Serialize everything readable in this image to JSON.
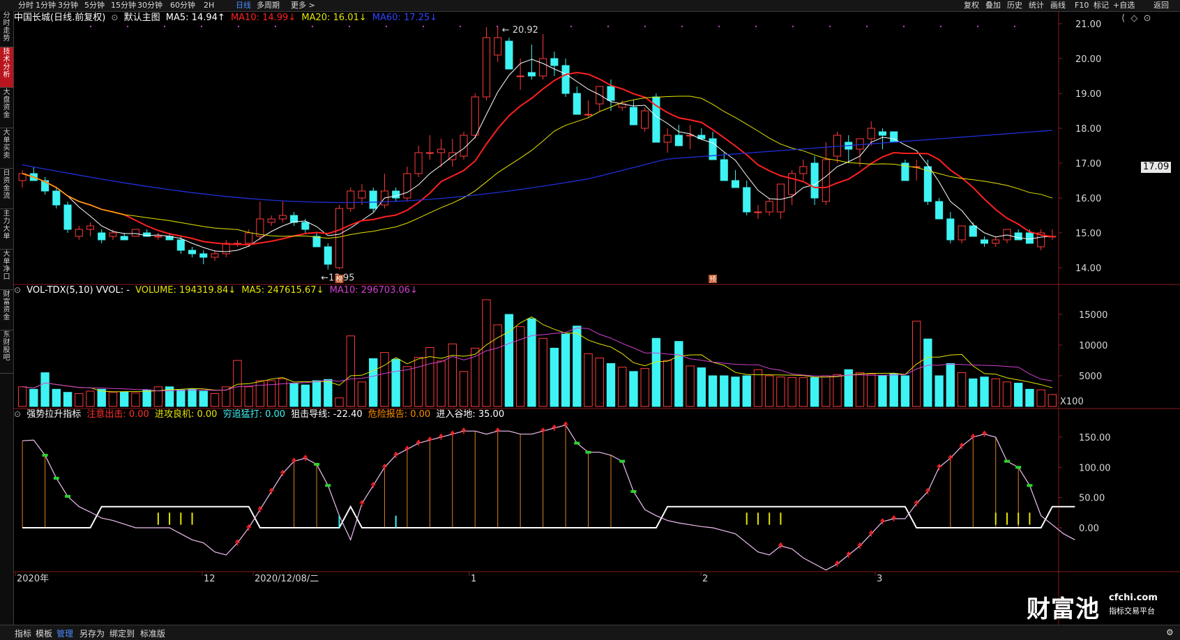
{
  "top_periods": [
    "分时",
    "1分钟",
    "3分钟",
    "5分钟",
    "15分钟",
    "30分钟",
    "60分钟",
    "2H",
    "日线",
    "多周期",
    "更多 >"
  ],
  "active_period": "日线",
  "top_tools": [
    "复权",
    "叠加",
    "历史",
    "统计",
    "画线",
    "F10",
    "标记",
    "+自选",
    "返回"
  ],
  "sidebar_tabs": [
    "分时走势",
    "技术分析",
    "大盘资金",
    "大单买卖",
    "日资金流",
    "主力大单",
    "大单净口",
    "财富资金",
    "东财股吧"
  ],
  "active_sidebar": "技术分析",
  "main_legend": {
    "stock": "中国长城(日线.前复权)",
    "template": "默认主图",
    "ma5": "MA5: 14.94↑",
    "ma10": "MA10: 14.99↓",
    "ma20": "MA20: 16.01↓",
    "ma60": "MA60: 17.25↓"
  },
  "vol_legend": {
    "name": "VOL-TDX(5,10) VVOL: -",
    "volume": "VOLUME: 194319.84↓",
    "ma5": "MA5: 247615.67↓",
    "ma10": "MA10: 296703.06↓"
  },
  "ind_legend": {
    "name": "强势拉升指标",
    "a": "注意出击: 0.00",
    "b": "进攻良机: 0.00",
    "c": "穷追猛打: 0.00",
    "d": "狙击导线: -22.40",
    "e": "危险报告: 0.00",
    "f": "进入谷地: 35.00"
  },
  "price_axis": [
    "21.00",
    "20.00",
    "19.00",
    "18.00",
    "17.00",
    "16.00",
    "15.00",
    "14.00"
  ],
  "current_price": "17.09",
  "vol_axis": [
    "15000",
    "10000",
    "5000"
  ],
  "vol_unit": "X100",
  "ind_axis": [
    "150.00",
    "100.00",
    "50.00",
    "0.00"
  ],
  "high_label": "20.92",
  "low_label": "13.95",
  "date_axis": [
    "2020年",
    "12",
    "2020/12/08/二",
    "1",
    "2",
    "3"
  ],
  "marker_bang": "榜",
  "marker_yu": "预",
  "bottom_tabs": [
    "指标",
    "模板",
    "管理",
    "另存为",
    "绑定到",
    "标准版"
  ],
  "active_bottom": "管理",
  "watermark": {
    "brand": "财富池",
    "site": "cfchi.com",
    "slogan": "指标交易平台"
  },
  "colors": {
    "up": "#ff3b3b",
    "down": "#3ef3f3",
    "ma5": "#ffffff",
    "ma10": "#ff2020",
    "ma20": "#e6e600",
    "ma60": "#1f2fd9",
    "vma5": "#e6e600",
    "vma10": "#d040d0"
  },
  "chart_data": {
    "type": "candlestick",
    "candles": [
      [
        16.5,
        16.8,
        16.3,
        16.7
      ],
      [
        16.7,
        16.9,
        16.5,
        16.5
      ],
      [
        16.5,
        16.6,
        16.1,
        16.2
      ],
      [
        16.2,
        16.3,
        15.7,
        15.8
      ],
      [
        15.8,
        15.9,
        15.0,
        15.1
      ],
      [
        14.9,
        15.2,
        14.8,
        15.1
      ],
      [
        15.1,
        15.3,
        14.9,
        15.2
      ],
      [
        15.0,
        15.1,
        14.7,
        14.8
      ],
      [
        14.9,
        15.1,
        14.8,
        15.0
      ],
      [
        14.9,
        15.0,
        14.8,
        14.8
      ],
      [
        14.9,
        15.1,
        14.9,
        15.1
      ],
      [
        15.0,
        15.1,
        14.9,
        14.9
      ],
      [
        14.9,
        15.0,
        14.8,
        14.9
      ],
      [
        14.9,
        15.0,
        14.8,
        14.8
      ],
      [
        14.8,
        14.9,
        14.4,
        14.5
      ],
      [
        14.5,
        14.6,
        14.3,
        14.4
      ],
      [
        14.4,
        14.5,
        14.1,
        14.3
      ],
      [
        14.3,
        14.5,
        14.2,
        14.4
      ],
      [
        14.4,
        14.8,
        14.3,
        14.7
      ],
      [
        14.7,
        14.8,
        14.6,
        14.7
      ],
      [
        14.7,
        15.1,
        14.6,
        15.0
      ],
      [
        14.9,
        15.9,
        14.8,
        15.4
      ],
      [
        15.3,
        15.5,
        15.2,
        15.4
      ],
      [
        15.4,
        15.9,
        15.3,
        15.5
      ],
      [
        15.5,
        15.6,
        15.2,
        15.3
      ],
      [
        15.3,
        15.4,
        15.0,
        15.1
      ],
      [
        14.9,
        15.0,
        14.6,
        14.6
      ],
      [
        14.6,
        14.7,
        13.95,
        14.1
      ],
      [
        14.0,
        15.8,
        13.95,
        15.7
      ],
      [
        15.7,
        16.3,
        15.6,
        16.2
      ],
      [
        16.0,
        16.4,
        15.8,
        16.2
      ],
      [
        16.2,
        16.3,
        15.6,
        15.7
      ],
      [
        15.8,
        16.7,
        15.7,
        16.2
      ],
      [
        16.2,
        16.3,
        15.9,
        16.0
      ],
      [
        16.0,
        16.9,
        15.9,
        16.7
      ],
      [
        16.7,
        17.5,
        16.6,
        17.3
      ],
      [
        17.3,
        17.8,
        17.1,
        17.3
      ],
      [
        17.3,
        17.7,
        16.9,
        17.4
      ],
      [
        17.1,
        17.7,
        16.9,
        17.3
      ],
      [
        17.2,
        17.9,
        17.1,
        17.8
      ],
      [
        17.8,
        19.0,
        17.7,
        18.9
      ],
      [
        18.9,
        20.9,
        18.8,
        20.6
      ],
      [
        20.1,
        20.92,
        19.9,
        20.6
      ],
      [
        20.5,
        20.6,
        19.8,
        19.7
      ],
      [
        19.5,
        20.0,
        19.1,
        19.5
      ],
      [
        19.6,
        20.4,
        19.4,
        19.5
      ],
      [
        19.5,
        20.7,
        19.4,
        20.0
      ],
      [
        20.0,
        20.2,
        19.5,
        19.8
      ],
      [
        19.8,
        20.0,
        18.9,
        19.0
      ],
      [
        19.0,
        19.2,
        18.4,
        18.4
      ],
      [
        18.4,
        18.8,
        18.3,
        18.4
      ],
      [
        18.7,
        19.2,
        18.5,
        19.2
      ],
      [
        19.2,
        19.4,
        18.5,
        18.8
      ],
      [
        18.6,
        18.8,
        18.5,
        18.7
      ],
      [
        18.6,
        18.8,
        18.2,
        18.1
      ],
      [
        18.0,
        18.6,
        17.9,
        18.5
      ],
      [
        18.9,
        19.0,
        17.6,
        17.6
      ],
      [
        17.6,
        18.0,
        17.3,
        17.8
      ],
      [
        17.8,
        18.1,
        17.5,
        17.5
      ],
      [
        17.8,
        18.1,
        17.4,
        17.8
      ],
      [
        17.8,
        18.0,
        17.8,
        17.7
      ],
      [
        17.7,
        17.9,
        17.2,
        17.1
      ],
      [
        17.1,
        17.3,
        16.5,
        16.5
      ],
      [
        16.5,
        16.8,
        16.3,
        16.3
      ],
      [
        16.3,
        16.5,
        15.5,
        15.6
      ],
      [
        15.6,
        15.8,
        15.4,
        15.6
      ],
      [
        15.6,
        16.0,
        15.5,
        15.9
      ],
      [
        15.6,
        16.4,
        15.4,
        16.4
      ],
      [
        16.1,
        16.8,
        15.8,
        16.7
      ],
      [
        16.7,
        17.1,
        16.5,
        16.9
      ],
      [
        17.0,
        17.2,
        15.8,
        16.0
      ],
      [
        15.9,
        17.6,
        15.8,
        17.1
      ],
      [
        17.2,
        17.9,
        17.0,
        17.8
      ],
      [
        17.6,
        17.8,
        17.0,
        17.4
      ],
      [
        17.4,
        17.7,
        16.9,
        17.7
      ],
      [
        17.7,
        18.2,
        17.5,
        18.0
      ],
      [
        17.9,
        18.0,
        17.4,
        17.8
      ],
      [
        17.9,
        17.9,
        17.6,
        17.6
      ],
      [
        17.0,
        17.1,
        16.5,
        16.5
      ],
      [
        16.9,
        17.1,
        16.5,
        16.9
      ],
      [
        16.9,
        17.1,
        15.8,
        15.9
      ],
      [
        15.9,
        16.0,
        15.4,
        15.4
      ],
      [
        15.4,
        15.6,
        14.7,
        14.8
      ],
      [
        14.8,
        15.2,
        14.7,
        15.2
      ],
      [
        15.2,
        15.3,
        14.9,
        14.9
      ],
      [
        14.8,
        14.9,
        14.6,
        14.7
      ],
      [
        14.7,
        14.9,
        14.6,
        14.8
      ],
      [
        14.8,
        15.1,
        14.7,
        15.1
      ],
      [
        15.0,
        15.1,
        14.8,
        14.8
      ],
      [
        15.0,
        15.1,
        14.8,
        14.7
      ],
      [
        14.6,
        15.1,
        14.5,
        15.0
      ],
      [
        14.9,
        15.1,
        14.8,
        14.9
      ]
    ],
    "volume": [
      3200,
      2800,
      5500,
      2800,
      2300,
      2100,
      2500,
      2800,
      2300,
      2400,
      2200,
      2700,
      3200,
      3200,
      2700,
      2800,
      2500,
      2100,
      3200,
      7500,
      3200,
      4200,
      4200,
      4500,
      3800,
      3500,
      4200,
      4400,
      1400,
      11500,
      4000,
      7800,
      8800,
      7700,
      6500,
      8000,
      9600,
      7400,
      10200,
      5700,
      9500,
      17400,
      13300,
      15000,
      13000,
      14300,
      11100,
      9500,
      11800,
      13100,
      8600,
      7900,
      7000,
      6400,
      5700,
      6200,
      11100,
      7500,
      10600,
      6600,
      6300,
      5000,
      5000,
      4800,
      5000,
      6000,
      5000,
      4800,
      4700,
      4700,
      4700,
      5000,
      5200,
      6000,
      5500,
      5300,
      5000,
      5300,
      5000,
      13900,
      11000,
      5000,
      7000,
      5500,
      4500,
      4800,
      4500,
      4000,
      3800,
      2800,
      2700,
      1940
    ],
    "ind_top": [
      144,
      145,
      120,
      82,
      52,
      35,
      26,
      16,
      12,
      6,
      0,
      0,
      0,
      0,
      -10,
      -20,
      -25,
      -40,
      -45,
      -25,
      0,
      30,
      60,
      90,
      110,
      115,
      105,
      70,
      20,
      -20,
      40,
      70,
      100,
      120,
      130,
      140,
      145,
      150,
      155,
      160,
      160,
      155,
      160,
      160,
      155,
      155,
      160,
      165,
      170,
      140,
      125,
      125,
      120,
      110,
      60,
      30,
      20,
      12,
      8,
      5,
      2,
      0,
      -5,
      -10,
      -25,
      -40,
      -45,
      -30,
      -35,
      -50,
      -60,
      -70,
      -60,
      -45,
      -30,
      -10,
      10,
      15,
      15,
      40,
      60,
      100,
      115,
      135,
      150,
      155,
      150,
      110,
      100,
      70,
      20,
      5,
      -10,
      -20
    ]
  }
}
